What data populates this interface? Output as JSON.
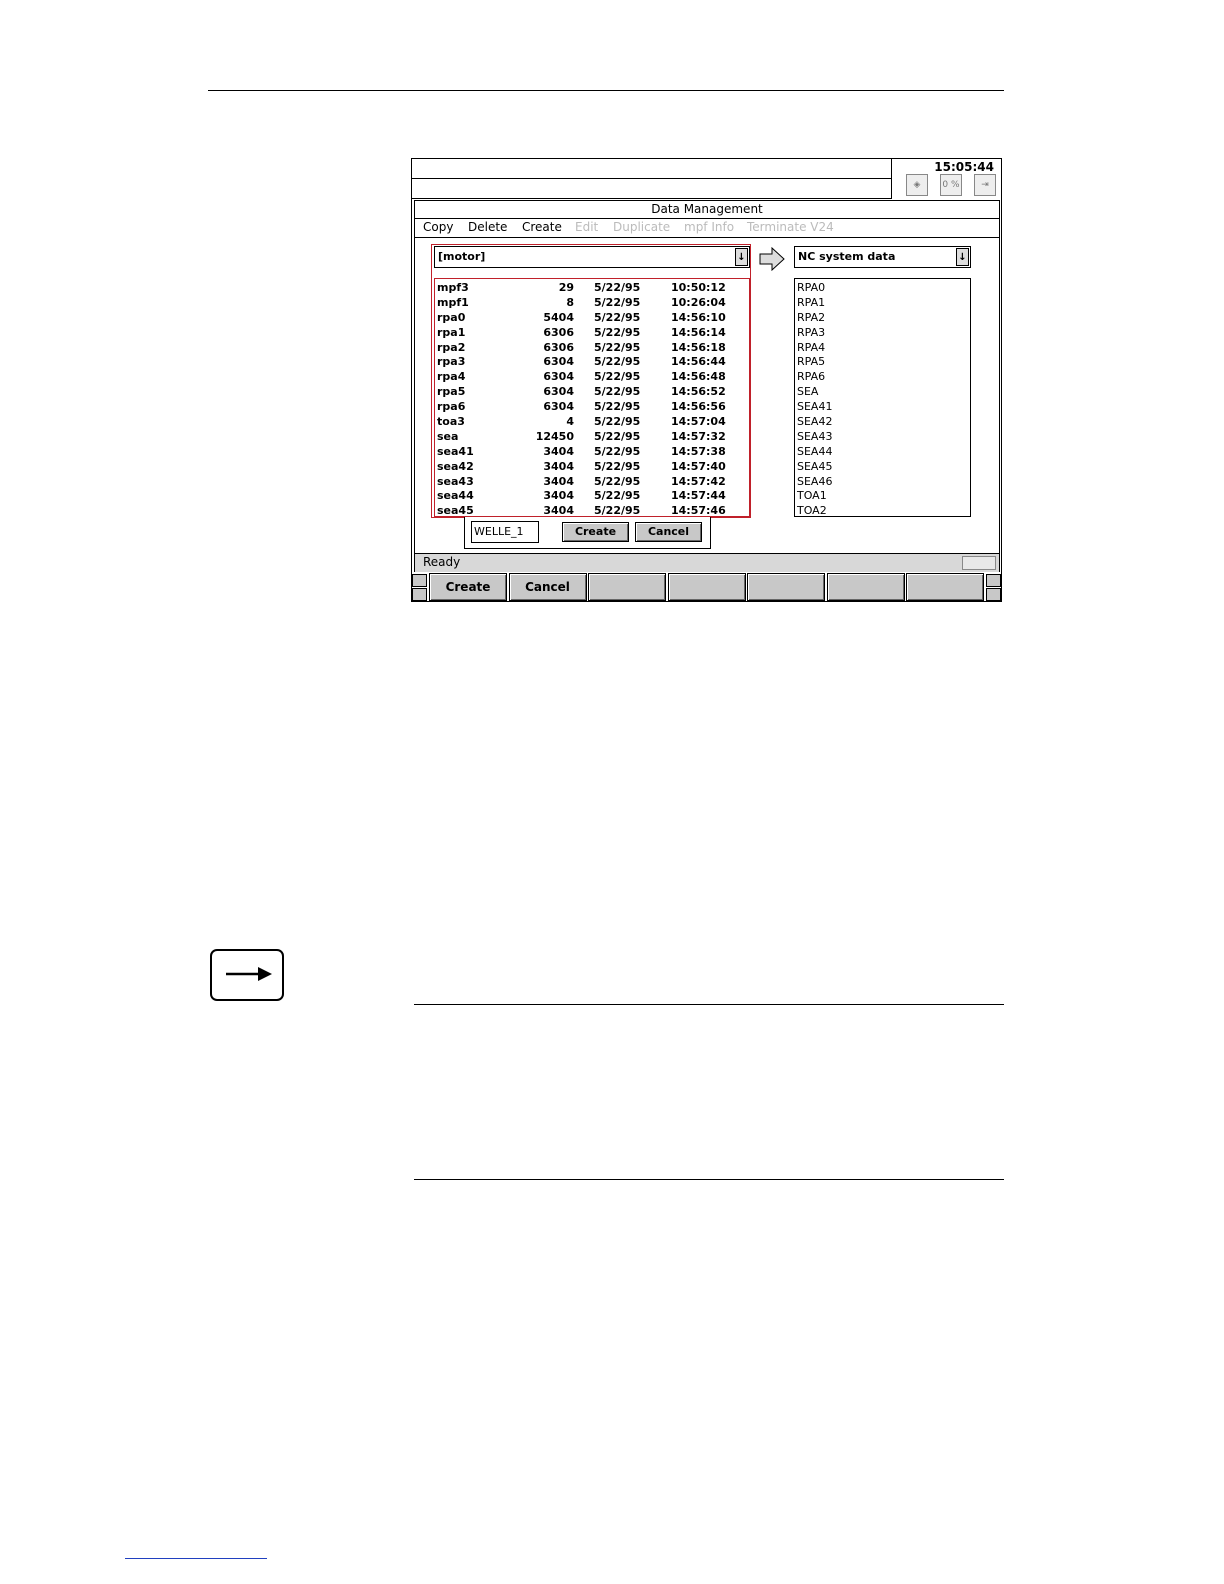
{
  "screen": {
    "clock": "15:05:44",
    "status_icon_label": "0 %",
    "window_title": "Data Management",
    "menu": [
      {
        "label": "Copy",
        "enabled": true
      },
      {
        "label": "Delete",
        "enabled": true
      },
      {
        "label": "Create",
        "enabled": true
      },
      {
        "label": "Edit",
        "enabled": false
      },
      {
        "label": "Duplicate",
        "enabled": false
      },
      {
        "label": "mpf Info",
        "enabled": false
      },
      {
        "label": "Terminate V24",
        "enabled": false
      }
    ],
    "source_dropdown": "[motor]",
    "target_dropdown": "NC system data",
    "source_files": [
      {
        "name": "mpf3",
        "size": "29",
        "date": "5/22/95",
        "time": "10:50:12"
      },
      {
        "name": "mpf1",
        "size": "8",
        "date": "5/22/95",
        "time": "10:26:04"
      },
      {
        "name": "rpa0",
        "size": "5404",
        "date": "5/22/95",
        "time": "14:56:10"
      },
      {
        "name": "rpa1",
        "size": "6306",
        "date": "5/22/95",
        "time": "14:56:14"
      },
      {
        "name": "rpa2",
        "size": "6306",
        "date": "5/22/95",
        "time": "14:56:18"
      },
      {
        "name": "rpa3",
        "size": "6304",
        "date": "5/22/95",
        "time": "14:56:44"
      },
      {
        "name": "rpa4",
        "size": "6304",
        "date": "5/22/95",
        "time": "14:56:48"
      },
      {
        "name": "rpa5",
        "size": "6304",
        "date": "5/22/95",
        "time": "14:56:52"
      },
      {
        "name": "rpa6",
        "size": "6304",
        "date": "5/22/95",
        "time": "14:56:56"
      },
      {
        "name": "toa3",
        "size": "4",
        "date": "5/22/95",
        "time": "14:57:04"
      },
      {
        "name": "sea",
        "size": "12450",
        "date": "5/22/95",
        "time": "14:57:32"
      },
      {
        "name": "sea41",
        "size": "3404",
        "date": "5/22/95",
        "time": "14:57:38"
      },
      {
        "name": "sea42",
        "size": "3404",
        "date": "5/22/95",
        "time": "14:57:40"
      },
      {
        "name": "sea43",
        "size": "3404",
        "date": "5/22/95",
        "time": "14:57:42"
      },
      {
        "name": "sea44",
        "size": "3404",
        "date": "5/22/95",
        "time": "14:57:44"
      },
      {
        "name": "sea45",
        "size": "3404",
        "date": "5/22/95",
        "time": "14:57:46"
      }
    ],
    "target_files": [
      "RPA0",
      "RPA1",
      "RPA2",
      "RPA3",
      "RPA4",
      "RPA5",
      "RPA6",
      "SEA",
      "SEA41",
      "SEA42",
      "SEA43",
      "SEA44",
      "SEA45",
      "SEA46",
      "TOA1",
      "TOA2"
    ],
    "create_dialog": {
      "input_value": "WELLE_1",
      "create_label": "Create",
      "cancel_label": "Cancel"
    },
    "status_text": "Ready",
    "softkeys": [
      "Create",
      "Cancel",
      "",
      "",
      "",
      "",
      ""
    ]
  },
  "colors": {
    "highlight_border": "#c0202a"
  }
}
